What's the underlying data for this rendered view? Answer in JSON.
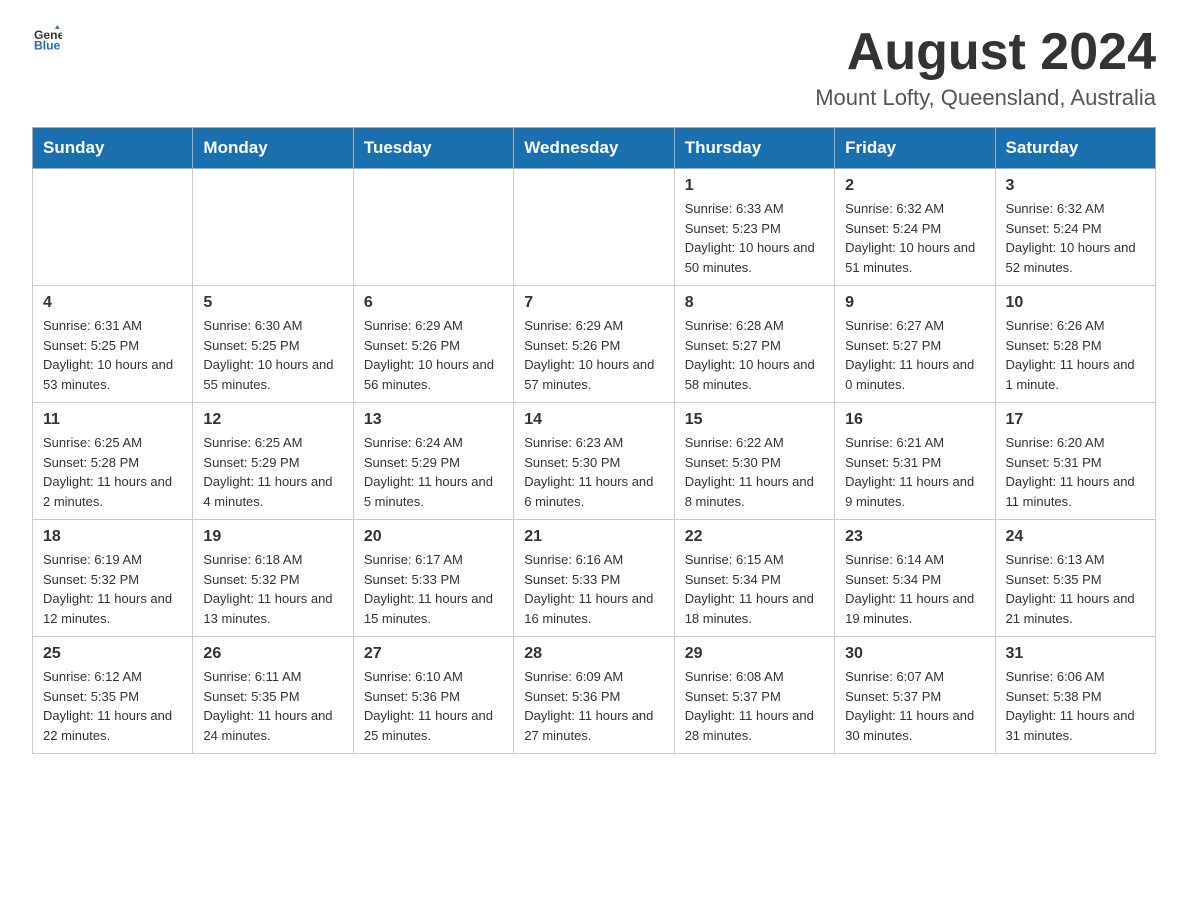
{
  "header": {
    "logo_general": "General",
    "logo_blue": "Blue",
    "title": "August 2024",
    "subtitle": "Mount Lofty, Queensland, Australia"
  },
  "weekdays": [
    "Sunday",
    "Monday",
    "Tuesday",
    "Wednesday",
    "Thursday",
    "Friday",
    "Saturday"
  ],
  "weeks": [
    [
      {
        "day": "",
        "sunrise": "",
        "sunset": "",
        "daylight": ""
      },
      {
        "day": "",
        "sunrise": "",
        "sunset": "",
        "daylight": ""
      },
      {
        "day": "",
        "sunrise": "",
        "sunset": "",
        "daylight": ""
      },
      {
        "day": "",
        "sunrise": "",
        "sunset": "",
        "daylight": ""
      },
      {
        "day": "1",
        "sunrise": "Sunrise: 6:33 AM",
        "sunset": "Sunset: 5:23 PM",
        "daylight": "Daylight: 10 hours and 50 minutes."
      },
      {
        "day": "2",
        "sunrise": "Sunrise: 6:32 AM",
        "sunset": "Sunset: 5:24 PM",
        "daylight": "Daylight: 10 hours and 51 minutes."
      },
      {
        "day": "3",
        "sunrise": "Sunrise: 6:32 AM",
        "sunset": "Sunset: 5:24 PM",
        "daylight": "Daylight: 10 hours and 52 minutes."
      }
    ],
    [
      {
        "day": "4",
        "sunrise": "Sunrise: 6:31 AM",
        "sunset": "Sunset: 5:25 PM",
        "daylight": "Daylight: 10 hours and 53 minutes."
      },
      {
        "day": "5",
        "sunrise": "Sunrise: 6:30 AM",
        "sunset": "Sunset: 5:25 PM",
        "daylight": "Daylight: 10 hours and 55 minutes."
      },
      {
        "day": "6",
        "sunrise": "Sunrise: 6:29 AM",
        "sunset": "Sunset: 5:26 PM",
        "daylight": "Daylight: 10 hours and 56 minutes."
      },
      {
        "day": "7",
        "sunrise": "Sunrise: 6:29 AM",
        "sunset": "Sunset: 5:26 PM",
        "daylight": "Daylight: 10 hours and 57 minutes."
      },
      {
        "day": "8",
        "sunrise": "Sunrise: 6:28 AM",
        "sunset": "Sunset: 5:27 PM",
        "daylight": "Daylight: 10 hours and 58 minutes."
      },
      {
        "day": "9",
        "sunrise": "Sunrise: 6:27 AM",
        "sunset": "Sunset: 5:27 PM",
        "daylight": "Daylight: 11 hours and 0 minutes."
      },
      {
        "day": "10",
        "sunrise": "Sunrise: 6:26 AM",
        "sunset": "Sunset: 5:28 PM",
        "daylight": "Daylight: 11 hours and 1 minute."
      }
    ],
    [
      {
        "day": "11",
        "sunrise": "Sunrise: 6:25 AM",
        "sunset": "Sunset: 5:28 PM",
        "daylight": "Daylight: 11 hours and 2 minutes."
      },
      {
        "day": "12",
        "sunrise": "Sunrise: 6:25 AM",
        "sunset": "Sunset: 5:29 PM",
        "daylight": "Daylight: 11 hours and 4 minutes."
      },
      {
        "day": "13",
        "sunrise": "Sunrise: 6:24 AM",
        "sunset": "Sunset: 5:29 PM",
        "daylight": "Daylight: 11 hours and 5 minutes."
      },
      {
        "day": "14",
        "sunrise": "Sunrise: 6:23 AM",
        "sunset": "Sunset: 5:30 PM",
        "daylight": "Daylight: 11 hours and 6 minutes."
      },
      {
        "day": "15",
        "sunrise": "Sunrise: 6:22 AM",
        "sunset": "Sunset: 5:30 PM",
        "daylight": "Daylight: 11 hours and 8 minutes."
      },
      {
        "day": "16",
        "sunrise": "Sunrise: 6:21 AM",
        "sunset": "Sunset: 5:31 PM",
        "daylight": "Daylight: 11 hours and 9 minutes."
      },
      {
        "day": "17",
        "sunrise": "Sunrise: 6:20 AM",
        "sunset": "Sunset: 5:31 PM",
        "daylight": "Daylight: 11 hours and 11 minutes."
      }
    ],
    [
      {
        "day": "18",
        "sunrise": "Sunrise: 6:19 AM",
        "sunset": "Sunset: 5:32 PM",
        "daylight": "Daylight: 11 hours and 12 minutes."
      },
      {
        "day": "19",
        "sunrise": "Sunrise: 6:18 AM",
        "sunset": "Sunset: 5:32 PM",
        "daylight": "Daylight: 11 hours and 13 minutes."
      },
      {
        "day": "20",
        "sunrise": "Sunrise: 6:17 AM",
        "sunset": "Sunset: 5:33 PM",
        "daylight": "Daylight: 11 hours and 15 minutes."
      },
      {
        "day": "21",
        "sunrise": "Sunrise: 6:16 AM",
        "sunset": "Sunset: 5:33 PM",
        "daylight": "Daylight: 11 hours and 16 minutes."
      },
      {
        "day": "22",
        "sunrise": "Sunrise: 6:15 AM",
        "sunset": "Sunset: 5:34 PM",
        "daylight": "Daylight: 11 hours and 18 minutes."
      },
      {
        "day": "23",
        "sunrise": "Sunrise: 6:14 AM",
        "sunset": "Sunset: 5:34 PM",
        "daylight": "Daylight: 11 hours and 19 minutes."
      },
      {
        "day": "24",
        "sunrise": "Sunrise: 6:13 AM",
        "sunset": "Sunset: 5:35 PM",
        "daylight": "Daylight: 11 hours and 21 minutes."
      }
    ],
    [
      {
        "day": "25",
        "sunrise": "Sunrise: 6:12 AM",
        "sunset": "Sunset: 5:35 PM",
        "daylight": "Daylight: 11 hours and 22 minutes."
      },
      {
        "day": "26",
        "sunrise": "Sunrise: 6:11 AM",
        "sunset": "Sunset: 5:35 PM",
        "daylight": "Daylight: 11 hours and 24 minutes."
      },
      {
        "day": "27",
        "sunrise": "Sunrise: 6:10 AM",
        "sunset": "Sunset: 5:36 PM",
        "daylight": "Daylight: 11 hours and 25 minutes."
      },
      {
        "day": "28",
        "sunrise": "Sunrise: 6:09 AM",
        "sunset": "Sunset: 5:36 PM",
        "daylight": "Daylight: 11 hours and 27 minutes."
      },
      {
        "day": "29",
        "sunrise": "Sunrise: 6:08 AM",
        "sunset": "Sunset: 5:37 PM",
        "daylight": "Daylight: 11 hours and 28 minutes."
      },
      {
        "day": "30",
        "sunrise": "Sunrise: 6:07 AM",
        "sunset": "Sunset: 5:37 PM",
        "daylight": "Daylight: 11 hours and 30 minutes."
      },
      {
        "day": "31",
        "sunrise": "Sunrise: 6:06 AM",
        "sunset": "Sunset: 5:38 PM",
        "daylight": "Daylight: 11 hours and 31 minutes."
      }
    ]
  ]
}
